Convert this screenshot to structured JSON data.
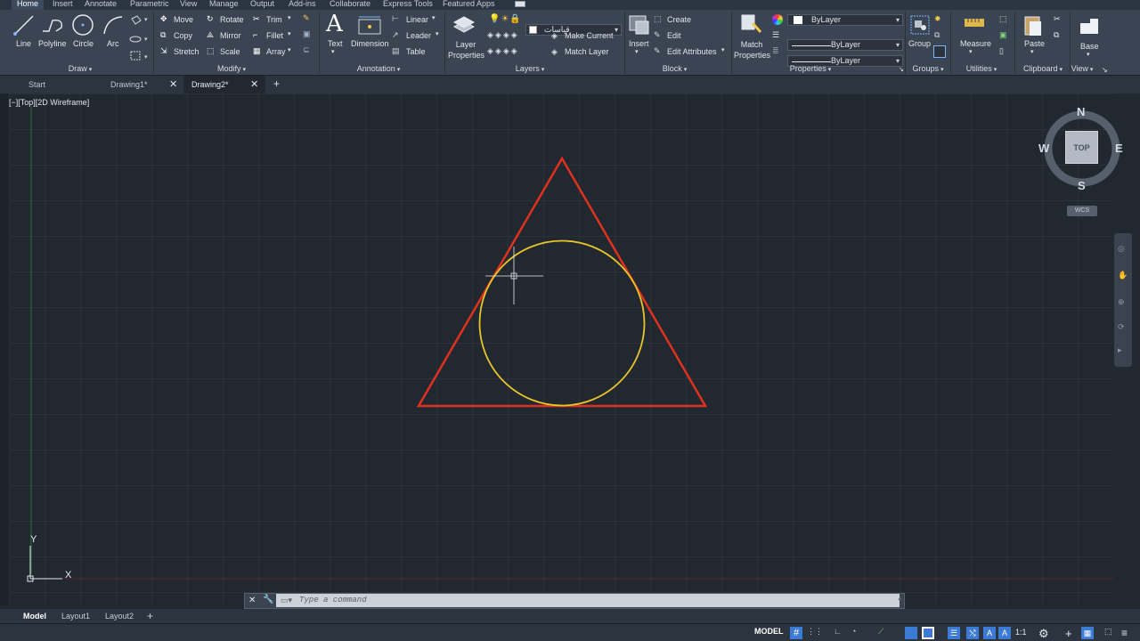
{
  "menu": {
    "tabs": [
      "Home",
      "Insert",
      "Annotate",
      "Parametric",
      "View",
      "Manage",
      "Output",
      "Add-ins",
      "Collaborate",
      "Express Tools",
      "Featured Apps"
    ]
  },
  "ribbon": {
    "draw": {
      "title": "Draw",
      "line": "Line",
      "polyline": "Polyline",
      "circle": "Circle",
      "arc": "Arc"
    },
    "modify": {
      "title": "Modify",
      "move": "Move",
      "rotate": "Rotate",
      "trim": "Trim",
      "copy": "Copy",
      "mirror": "Mirror",
      "fillet": "Fillet",
      "stretch": "Stretch",
      "scale": "Scale",
      "array": "Array"
    },
    "annotation": {
      "title": "Annotation",
      "text": "Text",
      "dimension": "Dimension",
      "linear": "Linear",
      "leader": "Leader",
      "table": "Table"
    },
    "layers": {
      "title": "Layers",
      "layer_properties": "Layer Properties",
      "current_layer": "قياسات",
      "make_current": "Make Current",
      "match_layer": "Match Layer"
    },
    "block": {
      "title": "Block",
      "insert": "Insert",
      "create": "Create",
      "edit": "Edit",
      "edit_attributes": "Edit Attributes"
    },
    "properties": {
      "title": "Properties",
      "match_properties": "Match Properties",
      "color": "ByLayer",
      "linetype": "ByLayer",
      "lineweight": "ByLayer"
    },
    "groups": {
      "title": "Groups",
      "group": "Group"
    },
    "utilities": {
      "title": "Utilities",
      "measure": "Measure"
    },
    "clipboard": {
      "title": "Clipboard",
      "paste": "Paste"
    },
    "view": {
      "title": "View",
      "base": "Base"
    }
  },
  "file_tabs": [
    "Start",
    "Drawing1*",
    "Drawing2*"
  ],
  "active_file_tab": "Drawing2*",
  "viewport_label": "[−][Top][2D Wireframe]",
  "viewcube": {
    "north": "N",
    "south": "S",
    "east": "E",
    "west": "W",
    "face": "TOP",
    "wcs": "WCS"
  },
  "ucs": {
    "x": "X",
    "y": "Y"
  },
  "command": {
    "placeholder": "Type a command"
  },
  "layout_tabs": [
    "Model",
    "Layout1",
    "Layout2"
  ],
  "status": {
    "model": "MODEL",
    "scale": "1:1"
  },
  "colors": {
    "triangle": "#e0301e",
    "circle": "#e8c52a",
    "background": "#212830",
    "ribbon": "#3b4453"
  }
}
